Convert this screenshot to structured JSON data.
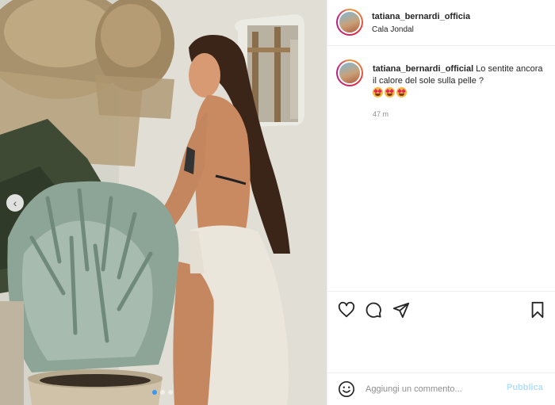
{
  "post": {
    "username": "tatiana_bernardi_official",
    "location": "Cala Jondal"
  },
  "caption": {
    "username": "tatiana_bernardi_official",
    "text": "Lo sentite ancora il calore del sole sulla pelle ?",
    "emojis": [
      "star-struck-emoji",
      "star-struck-emoji",
      "star-struck-emoji"
    ],
    "time": "47 m"
  },
  "carousel": {
    "prev_icon": "chevron-left-icon",
    "slide_count": 3,
    "active_slide": 1
  },
  "actions": {
    "icons": [
      "heart-icon",
      "comment-icon",
      "share-icon",
      "bookmark-icon"
    ]
  },
  "comment_box": {
    "placeholder": "Aggiungi un commento...",
    "publish_label": "Pubblica",
    "emoji_icon": "smile-icon"
  },
  "colors": {
    "link_blue_disabled": "#b2dffc",
    "active_dot": "#3897f0",
    "text": "#262626",
    "muted": "#8e8e8e"
  }
}
